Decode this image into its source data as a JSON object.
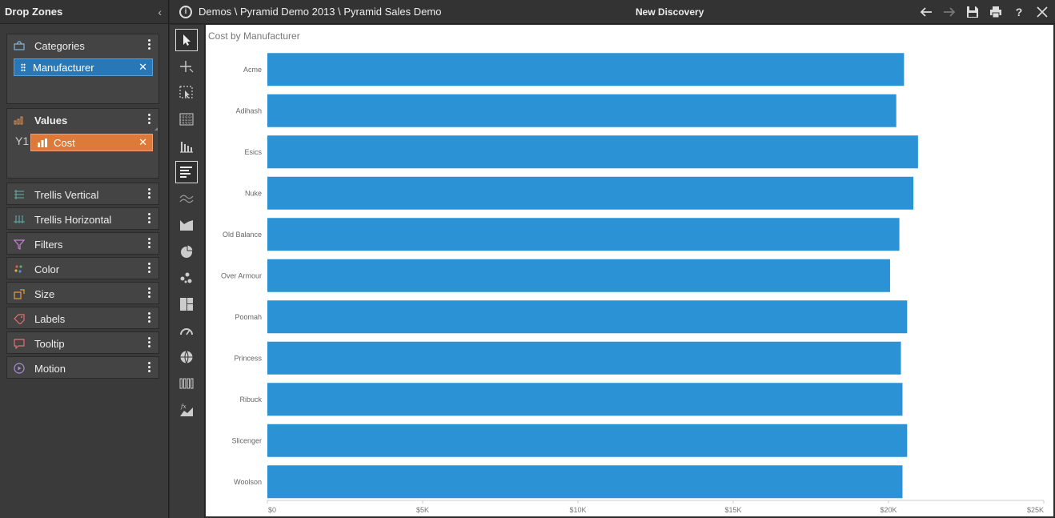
{
  "left_panel": {
    "title": "Drop Zones",
    "collapse_icon": "chevron-left-icon",
    "categories": {
      "label": "Categories",
      "icon": "categories-icon",
      "pill": "Manufacturer"
    },
    "values": {
      "label": "Values",
      "icon": "bar-chart-icon",
      "axis_label": "Y1",
      "pill": "Cost"
    },
    "zones": [
      {
        "label": "Trellis Vertical",
        "icon": "trellis-vertical-icon"
      },
      {
        "label": "Trellis Horizontal",
        "icon": "trellis-horizontal-icon"
      },
      {
        "label": "Filters",
        "icon": "filter-icon"
      },
      {
        "label": "Color",
        "icon": "color-palette-icon"
      },
      {
        "label": "Size",
        "icon": "size-icon"
      },
      {
        "label": "Labels",
        "icon": "tag-icon"
      },
      {
        "label": "Tooltip",
        "icon": "tooltip-icon"
      },
      {
        "label": "Motion",
        "icon": "play-icon"
      }
    ]
  },
  "header": {
    "breadcrumb": "Demos \\ Pyramid Demo 2013 \\ Pyramid Sales Demo",
    "center_title": "New Discovery",
    "actions": [
      "back-arrow-icon",
      "forward-arrow-icon",
      "save-icon",
      "print-icon",
      "help-icon",
      "close-icon"
    ]
  },
  "toolbar": {
    "tools": [
      "pointer-icon",
      "add-icon",
      "select-region-icon",
      "grid-icon",
      "column-chart-icon",
      "bar-chart-icon",
      "line-chart-icon",
      "area-chart-icon",
      "pie-chart-icon",
      "scatter-icon",
      "treemap-icon",
      "gauge-icon",
      "globe-icon",
      "indicator-icon",
      "formula-chart-icon"
    ],
    "active_index": 5
  },
  "colors": {
    "bar": "#2b92d5",
    "accent_blue": "#2878b8",
    "accent_orange": "#dd7a3a"
  },
  "chart_data": {
    "type": "bar",
    "orientation": "horizontal",
    "title": "Cost by Manufacturer",
    "categories": [
      "Acme",
      "Adihash",
      "Esics",
      "Nuke",
      "Old Balance",
      "Over Armour",
      "Poomah",
      "Princess",
      "Ribuck",
      "Slicenger",
      "Woolson"
    ],
    "values": [
      20500,
      20250,
      20950,
      20800,
      20350,
      20050,
      20600,
      20400,
      20450,
      20600,
      20450
    ],
    "xlim": [
      0,
      25000
    ],
    "xticks": [
      "$0",
      "$5K",
      "$10K",
      "$15K",
      "$20K",
      "$25K"
    ],
    "xtick_values": [
      0,
      5000,
      10000,
      15000,
      20000,
      25000
    ],
    "grid": false,
    "legend": "none"
  }
}
